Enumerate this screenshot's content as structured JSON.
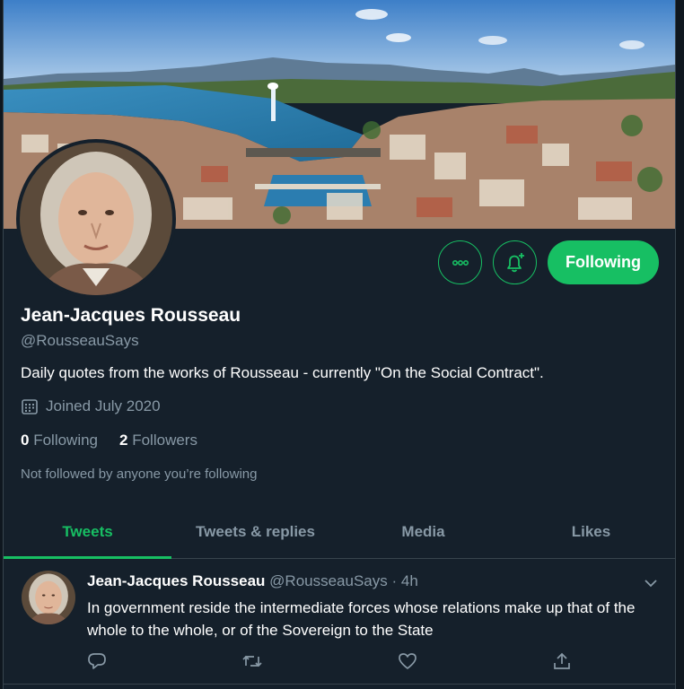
{
  "profile": {
    "name": "Jean-Jacques Rousseau",
    "handle": "@RousseauSays",
    "bio": "Daily quotes from the works of Rousseau - currently \"On the Social Contract\".",
    "joined": "Joined July 2020",
    "following_count": "0",
    "following_label": "Following",
    "followers_count": "2",
    "followers_label": "Followers",
    "not_followed": "Not followed by anyone you’re following"
  },
  "actions": {
    "more_icon": "more-icon",
    "notify_icon": "bell-plus-icon",
    "follow_button": "Following"
  },
  "tabs": [
    {
      "label": "Tweets",
      "active": true
    },
    {
      "label": "Tweets & replies",
      "active": false
    },
    {
      "label": "Media",
      "active": false
    },
    {
      "label": "Likes",
      "active": false
    }
  ],
  "tweet": {
    "name": "Jean-Jacques Rousseau",
    "handle": "@RousseauSays",
    "time": "· 4h",
    "text": "In government reside the intermediate forces whose relations make up that of the whole to the whole, or of the Sovereign to the State"
  },
  "colors": {
    "accent": "#17bf63",
    "background": "#15202b",
    "muted": "#8899a6"
  }
}
